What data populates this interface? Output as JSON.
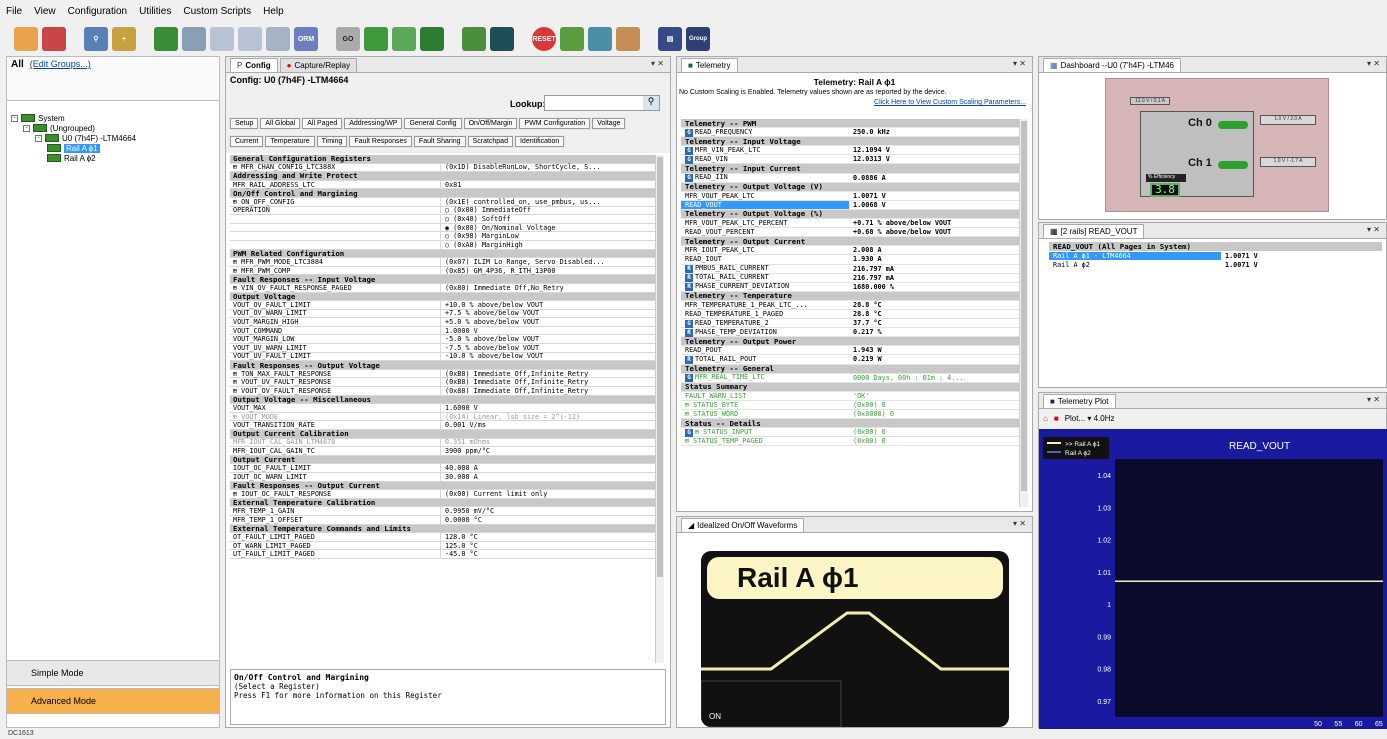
{
  "menu": [
    "File",
    "View",
    "Configuration",
    "Utilities",
    "Custom Scripts",
    "Help"
  ],
  "toolbar": {
    "buttons": [
      "open-icon",
      "save-icon",
      "find-icon",
      "add-icon",
      "chip-icon",
      "grid-icon",
      "copy-icon",
      "paste-icon",
      "trash-icon",
      "db-icon",
      "go-ram-icon",
      "pc-ram-icon",
      "pc-rom-icon",
      "wave-icon",
      "rs-icon",
      "reset-icon",
      "prog-icon",
      "prog2-icon",
      "nvm-icon",
      "board-icon",
      "group-icon"
    ],
    "labels": {
      "go": "GO",
      "orm": "ORM",
      "reset": "RESET",
      "group": "Group"
    }
  },
  "left": {
    "all_label": "All",
    "edit_groups": "(Edit Groups...)",
    "tree": [
      {
        "label": "System",
        "level": 0,
        "expand": "-"
      },
      {
        "label": "(Ungrouped)",
        "level": 1,
        "expand": "-"
      },
      {
        "label": "U0 (7h4F) -LTM4664",
        "level": 2,
        "expand": "-"
      },
      {
        "label": "Rail A ϕ1",
        "level": 3,
        "expand": "",
        "selected": true
      },
      {
        "label": "Rail A ϕ2",
        "level": 3,
        "expand": ""
      }
    ],
    "simple_mode": "Simple Mode",
    "advanced_mode": "Advanced Mode"
  },
  "config_panel": {
    "tabs": [
      "Config",
      "Capture/Replay"
    ],
    "title": "Config: U0 (7h4F) -LTM4664",
    "lookup_label": "Lookup:",
    "subtabs_row1": [
      "Setup",
      "All Global",
      "All Paged",
      "Addressing/WP",
      "General Config",
      "On/Off/Margin",
      "PWM Configuration",
      "Voltage"
    ],
    "subtabs_row2": [
      "Current",
      "Temperature",
      "Timing",
      "Fault Responses",
      "Fault Sharing",
      "Scratchpad",
      "Identification"
    ],
    "rows": [
      {
        "t": "sec",
        "n": "General Configuration Registers"
      },
      {
        "n": "⊞ MFR_CHAN_CONFIG_LTC388X",
        "v": "(0x1D)  DisableRunLow, ShortCycle, S..."
      },
      {
        "t": "sec",
        "n": "Addressing and Write Protect"
      },
      {
        "n": "MFR_RAIL_ADDRESS_LTC",
        "v": "0x81"
      },
      {
        "t": "sec",
        "n": "On/Off Control and Margining"
      },
      {
        "n": "⊞ ON_OFF_CONFIG",
        "v": "(0x1E)  controlled_on, use_pmbus, us..."
      },
      {
        "n": "OPERATION",
        "v": "○ (0x00) ImmediateOff"
      },
      {
        "n": "",
        "v": "○ (0x40) SoftOff"
      },
      {
        "n": "",
        "v": "◉ (0x80) On/Nominal Voltage"
      },
      {
        "n": "",
        "v": "○ (0x98) MarginLow"
      },
      {
        "n": "",
        "v": "○ (0xA8) MarginHigh"
      },
      {
        "t": "sec",
        "n": "PWM Related Configuration"
      },
      {
        "n": "⊞ MFR_PWM_MODE_LTC3884",
        "v": "(0x07) ILIM Lo Range, Servo Disabled..."
      },
      {
        "n": "⊞ MFR_PWM_COMP",
        "v": "(0x85) GM_4P36, R_ITH_13P00"
      },
      {
        "t": "sec",
        "n": "Fault Responses -- Input Voltage"
      },
      {
        "n": "⊞ VIN_OV_FAULT_RESPONSE_PAGED",
        "v": "(0x80) Immediate Off,No_Retry"
      },
      {
        "t": "sec",
        "n": "Output Voltage"
      },
      {
        "n": "VOUT_OV_FAULT_LIMIT",
        "v": "+10.0 % above/below VOUT"
      },
      {
        "n": "VOUT_OV_WARN_LIMIT",
        "v": "+7.5 % above/below VOUT"
      },
      {
        "n": "VOUT_MARGIN_HIGH",
        "v": "+5.0 % above/below VOUT"
      },
      {
        "n": "VOUT_COMMAND",
        "v": "1.0000 V"
      },
      {
        "n": "VOUT_MARGIN_LOW",
        "v": "-5.0 % above/below VOUT"
      },
      {
        "n": "VOUT_UV_WARN_LIMIT",
        "v": "-7.5 % above/below VOUT"
      },
      {
        "n": "VOUT_UV_FAULT_LIMIT",
        "v": "-10.0 % above/below VOUT"
      },
      {
        "t": "sec",
        "n": "Fault Responses -- Output Voltage"
      },
      {
        "n": "⊞ TON_MAX_FAULT_RESPONSE",
        "v": "(0xB8) Immediate Off,Infinite_Retry"
      },
      {
        "n": "⊞ VOUT_UV_FAULT_RESPONSE",
        "v": "(0xB8) Immediate Off,Infinite_Retry"
      },
      {
        "n": "⊞ VOUT_OV_FAULT_RESPONSE",
        "v": "(0x88) Immediate Off,Infinite_Retry"
      },
      {
        "t": "sec",
        "n": "Output Voltage -- Miscellaneous"
      },
      {
        "n": "VOUT_MAX",
        "v": "1.6000 V"
      },
      {
        "t": "grey",
        "n": "⊞ VOUT_MODE",
        "v": "(0x14) Linear, lsb_size = 2^(-12)"
      },
      {
        "n": "VOUT_TRANSITION_RATE",
        "v": "0.001 V/ms"
      },
      {
        "t": "sec",
        "n": "Output Current Calibration"
      },
      {
        "t": "grey",
        "n": "MFR_IOUT_CAL_GAIN_LTM4678",
        "v": "0.351 mOhms"
      },
      {
        "n": "MFR_IOUT_CAL_GAIN_TC",
        "v": "3900 ppm/°C"
      },
      {
        "t": "sec",
        "n": "Output Current"
      },
      {
        "n": "IOUT_OC_FAULT_LIMIT",
        "v": "40.000  A"
      },
      {
        "n": "IOUT_OC_WARN_LIMIT",
        "v": "30.000  A"
      },
      {
        "t": "sec",
        "n": "Fault Responses -- Output Current"
      },
      {
        "n": "⊞ IOUT_OC_FAULT_RESPONSE",
        "v": "(0x00) Current limit only"
      },
      {
        "t": "sec",
        "n": "External Temperature Calibration"
      },
      {
        "n": "MFR_TEMP_1_GAIN",
        "v": "0.9950 mV/°C"
      },
      {
        "n": "MFR_TEMP_1_OFFSET",
        "v": "0.0000 °C"
      },
      {
        "t": "sec",
        "n": "External Temperature Commands and Limits"
      },
      {
        "n": "OT_FAULT_LIMIT_PAGED",
        "v": "128.0 °C"
      },
      {
        "n": "OT_WARN_LIMIT_PAGED",
        "v": "125.0 °C"
      },
      {
        "n": "UT_FAULT_LIMIT_PAGED",
        "v": "-45.0 °C"
      }
    ],
    "desc_title": "On/Off Control and Margining",
    "desc_line1": "(Select a Register)",
    "desc_line2": "Press F1 for more information on this Register"
  },
  "telemetry": {
    "tab": "Telemetry",
    "title": "Telemetry: Rail A ϕ1",
    "note": "No Custom Scaling is Enabled.  Telemetry values shown are as reported by the device.",
    "link": "Click Here to View Custom Scaling Parameters...",
    "rows": [
      {
        "t": "sec",
        "n": "Telemetry -- PWM"
      },
      {
        "i": "G",
        "n": "READ_FREQUENCY",
        "v": "250.0 kHz"
      },
      {
        "t": "sec",
        "n": "Telemetry -- Input Voltage"
      },
      {
        "i": "G",
        "n": "MFR_VIN_PEAK_LTC",
        "v": "12.1094 V"
      },
      {
        "i": "G",
        "n": "READ_VIN",
        "v": "12.0313 V"
      },
      {
        "t": "sec",
        "n": "Telemetry -- Input Current"
      },
      {
        "i": "G",
        "n": "READ_IIN",
        "v": "0.0886 A"
      },
      {
        "t": "sec",
        "n": "Telemetry -- Output Voltage (V)"
      },
      {
        "n": "MFR_VOUT_PEAK_LTC",
        "v": "1.0071 V"
      },
      {
        "t": "sel",
        "n": "READ_VOUT",
        "v": "1.0068 V"
      },
      {
        "t": "sec",
        "n": "Telemetry -- Output Voltage (%)"
      },
      {
        "n": "MFR_VOUT_PEAK_LTC_PERCENT",
        "v": "+0.71 % above/below VOUT"
      },
      {
        "n": "READ_VOUT_PERCENT",
        "v": "+0.68 % above/below VOUT"
      },
      {
        "t": "sec",
        "n": "Telemetry -- Output Current"
      },
      {
        "n": "MFR_IOUT_PEAK_LTC",
        "v": "2.008  A"
      },
      {
        "n": "READ_IOUT",
        "v": "1.930  A"
      },
      {
        "i": "R",
        "n": "PMBUS_RAIL_CURRENT",
        "v": "216.797 mA"
      },
      {
        "i": "R",
        "n": "TOTAL_RAIL_CURRENT",
        "v": "216.797 mA"
      },
      {
        "i": "R",
        "n": "PHASE_CURRENT_DEVIATION",
        "v": "1680.000 %"
      },
      {
        "t": "sec",
        "n": "Telemetry -- Temperature"
      },
      {
        "n": "MFR_TEMPERATURE_1_PEAK_LTC_...",
        "v": "28.8 °C"
      },
      {
        "n": "READ_TEMPERATURE_1_PAGED",
        "v": "28.8 °C"
      },
      {
        "i": "G",
        "n": "READ_TEMPERATURE_2",
        "v": "37.7 °C"
      },
      {
        "i": "R",
        "n": "PHASE_TEMP_DEVIATION",
        "v": " 0.217 %"
      },
      {
        "t": "sec",
        "n": "Telemetry -- Output Power"
      },
      {
        "n": "READ_POUT",
        "v": "1.943 W"
      },
      {
        "i": "R",
        "n": "TOTAL_RAIL_POUT",
        "v": "0.219 W"
      },
      {
        "t": "sec",
        "n": "Telemetry -- General"
      },
      {
        "t": "green",
        "i": "G",
        "n": "MFR_REAL_TIME_LTC",
        "v": "0000 Days, 00h : 01m : 4..."
      },
      {
        "t": "sec",
        "n": "Status Summary"
      },
      {
        "t": "green",
        "n": "FAULT_WARN_LIST",
        "v": "'OK'"
      },
      {
        "t": "green",
        "n": "⊞ STATUS_BYTE",
        "v": "(0x00) 0"
      },
      {
        "t": "green",
        "n": "⊞ STATUS_WORD",
        "v": "(0x0000) 0"
      },
      {
        "t": "sec",
        "n": "Status -- Details"
      },
      {
        "t": "green",
        "i": "G",
        "n": "⊞ STATUS_INPUT",
        "v": "(0x00) 0"
      },
      {
        "t": "green",
        "n": "⊞ STATUS_TEMP_PAGED",
        "v": "(0x00) 0"
      }
    ]
  },
  "waveforms": {
    "tab": "Idealized On/Off Waveforms",
    "rail_label": "Rail A ϕ1",
    "on_label": "ON"
  },
  "dashboard": {
    "tab": "Dashboard --U0 (7'h4F) -LTM46",
    "ch0": "Ch 0",
    "ch1": "Ch 1",
    "ch0_tag": "1.0 V / 2.0 A",
    "ch1_tag": "1.0 V / -1.7 A",
    "vin_tag": "12.0 V / 0.1 A",
    "eff_label": "% Efficiency",
    "eff_value": "3.8"
  },
  "readvout": {
    "tab": "[2 rails] READ_VOUT",
    "header": "READ_VOUT (All Pages in System)",
    "rows": [
      {
        "n": "Rail A ϕ1 - LTM4664",
        "v": "1.0071 V",
        "sel": true
      },
      {
        "n": "Rail A ϕ2",
        "v": "1.0071 V"
      }
    ]
  },
  "plot": {
    "tab": "Telemetry Plot",
    "toolbar_label": "Plot... ▾ 4.0Hz"
  },
  "chart_data": {
    "type": "line",
    "title": "READ_VOUT",
    "xlabel": "",
    "ylabel": "",
    "ylim": [
      0.965,
      1.045
    ],
    "xlim": [
      0,
      66
    ],
    "yticks": [
      1.04,
      1.03,
      1.02,
      1.01,
      1,
      0.99,
      0.98,
      0.97
    ],
    "xticks": [
      50,
      55,
      60,
      65
    ],
    "series": [
      {
        "name": ">> Rail A ϕ1",
        "color": "#f2f0c0",
        "values": [
          1.0071,
          1.0071
        ]
      },
      {
        "name": "Rail A ϕ2",
        "color": "#5060d0",
        "values": [
          1.0071,
          1.0071
        ]
      }
    ],
    "x": [
      0,
      66
    ],
    "legend": "top-left",
    "grid": false,
    "colors": {
      "background": "#0a0a2a",
      "panel": "#1a1aa0"
    }
  },
  "status_bar": "DC1613"
}
